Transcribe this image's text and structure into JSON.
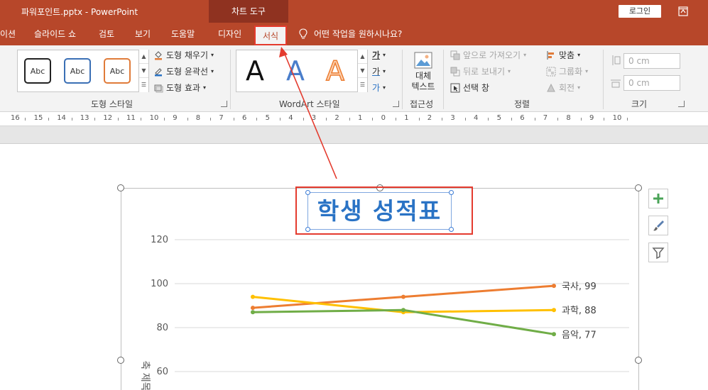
{
  "titlebar": {
    "doc_title": "파워포인트.pptx  -  PowerPoint",
    "context_tab": "차트 도구",
    "login": "로그인"
  },
  "tabs": [
    {
      "label": "이션"
    },
    {
      "label": "슬라이드 쇼"
    },
    {
      "label": "검토"
    },
    {
      "label": "보기"
    },
    {
      "label": "도움말"
    },
    {
      "label": "디자인"
    },
    {
      "label": "서식"
    }
  ],
  "tell_me": "어떤 작업을 원하시나요?",
  "ribbon": {
    "shape_styles": {
      "label": "도형 스타일",
      "swatch_text": "Abc",
      "fill": "도형 채우기",
      "outline": "도형 윤곽선",
      "effects": "도형 효과"
    },
    "wordart": {
      "label": "WordArt 스타일",
      "letter": "A",
      "text_fill_glyph": "가",
      "text_outline_glyph": "가",
      "text_effects_glyph": "가"
    },
    "accessibility": {
      "label": "접근성",
      "alt_text_line1": "대체",
      "alt_text_line2": "텍스트"
    },
    "arrange": {
      "label": "정렬",
      "bring_forward": "앞으로 가져오기",
      "send_backward": "뒤로 보내기",
      "selection_pane": "선택 창",
      "align": "맞춤",
      "group": "그룹화",
      "rotate": "회전"
    },
    "size": {
      "label": "크기",
      "height": "0 cm",
      "width": "0 cm"
    }
  },
  "ruler": [
    "16",
    "15",
    "14",
    "13",
    "12",
    "11",
    "10",
    "9",
    "8",
    "7",
    "6",
    "5",
    "4",
    "3",
    "2",
    "1",
    "0",
    "1",
    "2",
    "3",
    "4",
    "5",
    "6",
    "7",
    "8",
    "9",
    "10"
  ],
  "chart_data": {
    "type": "line",
    "title": "학생 성적표",
    "ylabel": "축 제목",
    "ylim": [
      60,
      120
    ],
    "y_ticks": [
      120,
      100,
      80,
      60
    ],
    "grid": true,
    "series": [
      {
        "name": "국사",
        "values": [
          89,
          94,
          99
        ],
        "color": "#ed7d31",
        "end_label": "국사, 99"
      },
      {
        "name": "과학",
        "values": [
          94,
          87,
          88
        ],
        "color": "#ffc000",
        "end_label": "과학, 88"
      },
      {
        "name": "음악",
        "values": [
          87,
          88,
          77
        ],
        "color": "#70ad47",
        "end_label": "음악, 77"
      }
    ]
  },
  "colors": {
    "accent": "#b7472a",
    "highlight": "#e43b2e",
    "title_text": "#2a73c5"
  }
}
